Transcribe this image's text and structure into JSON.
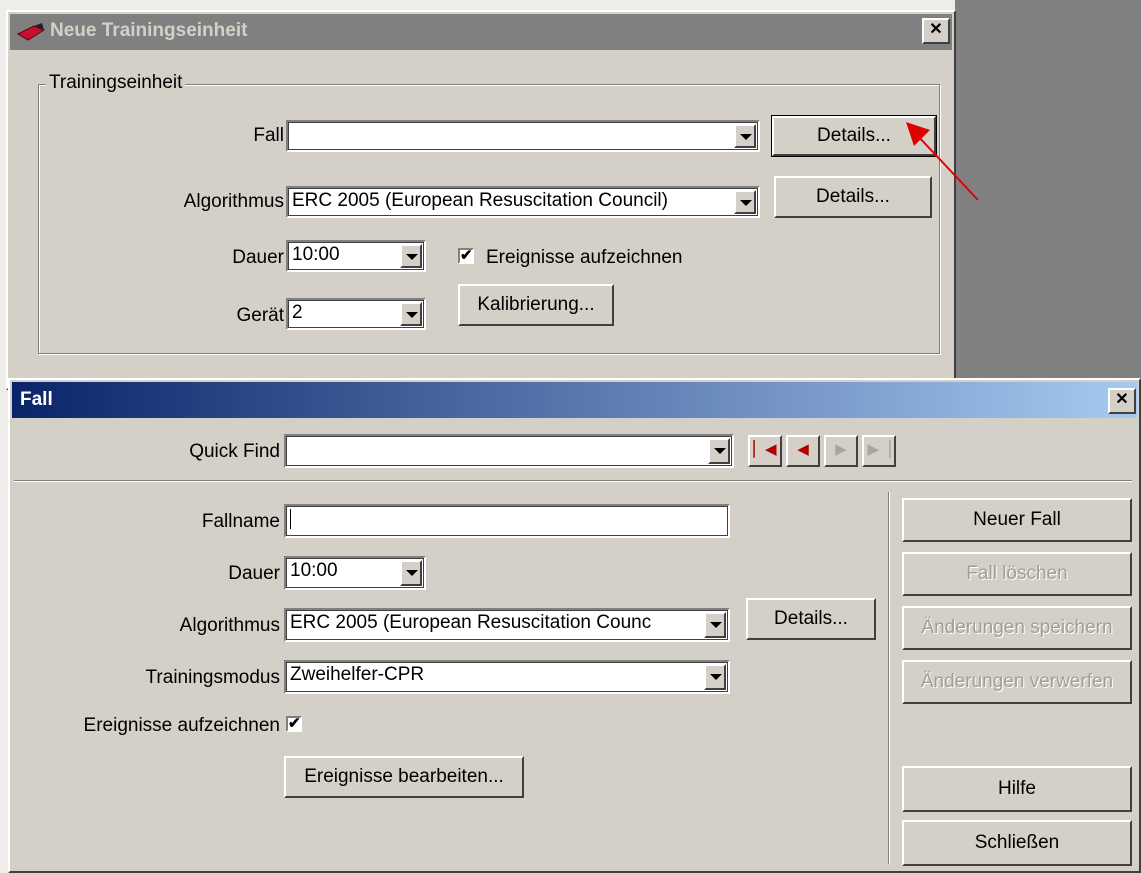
{
  "dialog1": {
    "title": "Neue Trainingseinheit",
    "close": "✕",
    "group_label": "Trainingseinheit",
    "fall_label": "Fall",
    "fall_value": "",
    "details1": "Details...",
    "algorithmus_label": "Algorithmus",
    "algorithmus_value": "ERC 2005 (European Resuscitation Council)",
    "details2": "Details...",
    "dauer_label": "Dauer",
    "dauer_value": "10:00",
    "ereignisse_label": "Ereignisse aufzeichnen",
    "ereignisse_checked": "✔",
    "geraet_label": "Gerät",
    "geraet_value": "2",
    "kalibrierung": "Kalibrierung..."
  },
  "dialog2": {
    "title": "Fall",
    "close": "✕",
    "quickfind_label": "Quick Find",
    "quickfind_value": "",
    "nav": [
      "▏◀",
      "◀",
      "▶",
      "▶▕"
    ],
    "fallname_label": "Fallname",
    "fallname_value": "",
    "dauer_label": "Dauer",
    "dauer_value": "10:00",
    "algorithmus_label": "Algorithmus",
    "algorithmus_value": "ERC 2005 (European Resuscitation Counc",
    "details": "Details...",
    "trainingsmodus_label": "Trainingsmodus",
    "trainingsmodus_value": "Zweihelfer-CPR",
    "ereignisse_label": "Ereignisse aufzeichnen",
    "ereignisse_checked": "✔",
    "ereignisse_bearbeiten": "Ereignisse bearbeiten...",
    "buttons": {
      "neuer_fall": "Neuer Fall",
      "fall_loeschen": "Fall löschen",
      "aenderungen_speichern": "Änderungen speichern",
      "aenderungen_verwerfen": "Änderungen verwerfen",
      "hilfe": "Hilfe",
      "schliessen": "Schließen"
    }
  },
  "colors": {
    "titlebar_inactive": "#808080",
    "titlebar_active_start": "#0a246a",
    "titlebar_active_end": "#a6caf0",
    "arrow": "#e00000"
  }
}
